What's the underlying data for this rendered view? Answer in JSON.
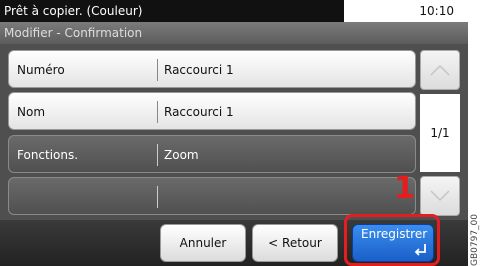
{
  "status": {
    "title": "Prêt à copier. (Couleur)",
    "time": "10:10"
  },
  "subtitle": "Modifier - Confirmation",
  "rows": [
    {
      "label": "Numéro",
      "value": "Raccourci 1"
    },
    {
      "label": "Nom",
      "value": "Raccourci 1"
    },
    {
      "label": "Fonctions.",
      "value": "Zoom"
    },
    {
      "label": "",
      "value": ""
    }
  ],
  "pagination": {
    "indicator": "1/1"
  },
  "buttons": {
    "cancel": "Annuler",
    "back": "< Retour",
    "save": "Enregistrer"
  },
  "annotation": {
    "step": "1",
    "figure_code": "GB0797_00"
  },
  "icons": {
    "scroll_up": "chevron-up-icon",
    "scroll_down": "chevron-down-icon",
    "enter": "enter-icon"
  },
  "colors": {
    "accent": "#1a5fc8",
    "callout": "#e41e1e"
  }
}
